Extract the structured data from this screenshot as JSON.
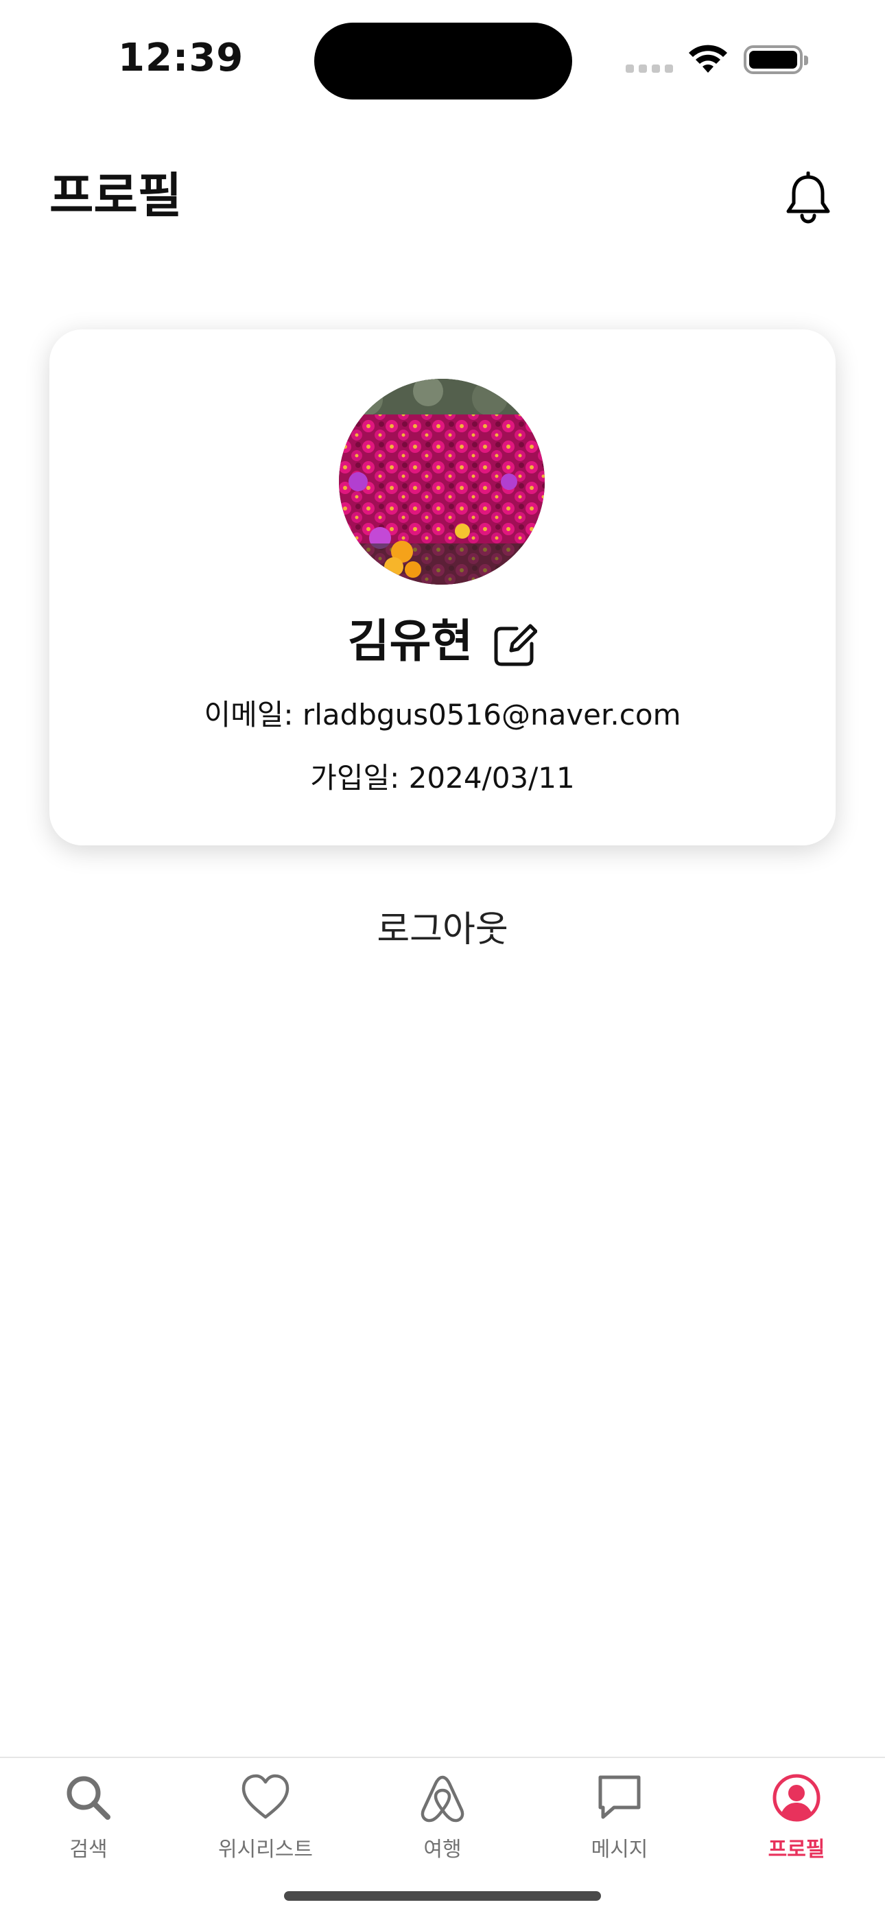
{
  "status_bar": {
    "time": "12:39"
  },
  "header": {
    "title": "프로필",
    "notification_icon": "bell-icon"
  },
  "profile": {
    "name": "김유현",
    "edit_icon": "edit-icon",
    "email": "이메일: rladbgus0516@naver.com",
    "joined": "가입일: 2024/03/11"
  },
  "logout_label": "로그아웃",
  "tabbar": {
    "active_color": "#e8325c",
    "items": [
      {
        "label": "검색",
        "icon": "search-icon"
      },
      {
        "label": "위시리스트",
        "icon": "heart-icon"
      },
      {
        "label": "여행",
        "icon": "airbnb-logo-icon"
      },
      {
        "label": "메시지",
        "icon": "message-icon"
      },
      {
        "label": "프로필",
        "icon": "profile-icon",
        "active": true
      }
    ]
  }
}
